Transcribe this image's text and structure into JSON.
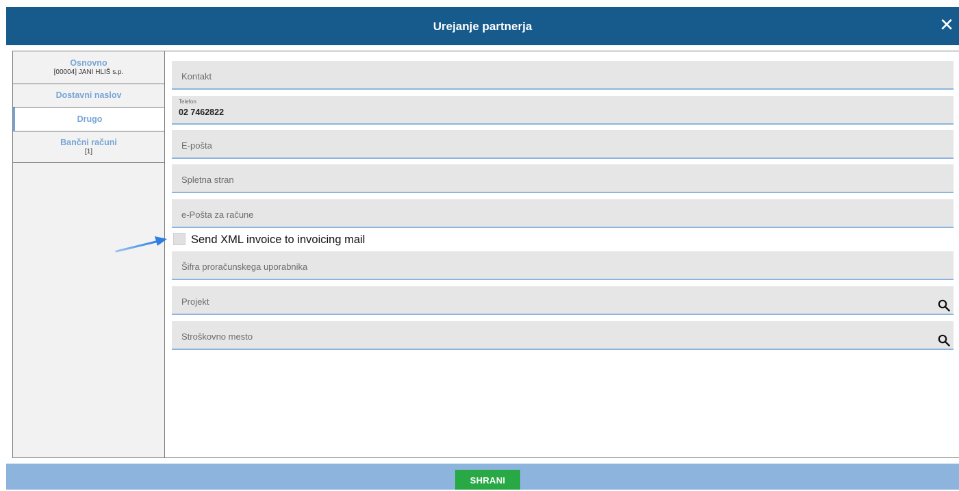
{
  "dialog": {
    "title": "Urejanje partnerja",
    "close_icon": "close-icon"
  },
  "sidebar": {
    "items": [
      {
        "label": "Osnovno",
        "sub": "[00004] JANI HLIŠ s.p."
      },
      {
        "label": "Dostavni naslov"
      },
      {
        "label": "Drugo",
        "active": true
      },
      {
        "label": "Bančni računi",
        "sub": "[1]"
      }
    ]
  },
  "form": {
    "kontakt": {
      "placeholder": "Kontakt"
    },
    "telefon": {
      "label": "Telefon",
      "value": "02 7462822"
    },
    "eposta": {
      "placeholder": "E-pošta"
    },
    "spletna_stran": {
      "placeholder": "Spletna stran"
    },
    "eposta_racuni": {
      "placeholder": "e-Pošta za račune"
    },
    "send_xml": {
      "label": "Send XML invoice to invoicing mail",
      "checked": false
    },
    "sifra": {
      "placeholder": "Šifra proračunskega uporabnika"
    },
    "projekt": {
      "placeholder": "Projekt",
      "icon": "search-icon"
    },
    "strosek": {
      "placeholder": "Stroškovno mesto",
      "icon": "search-icon"
    }
  },
  "footer": {
    "save_label": "SHRANI"
  },
  "colors": {
    "header": "#175b8c",
    "footer": "#8cb4dc",
    "save": "#28a945",
    "accent": "#78a5d6",
    "field_underline": "#8cb4de",
    "annotation_arrow": "#2f7de0"
  }
}
